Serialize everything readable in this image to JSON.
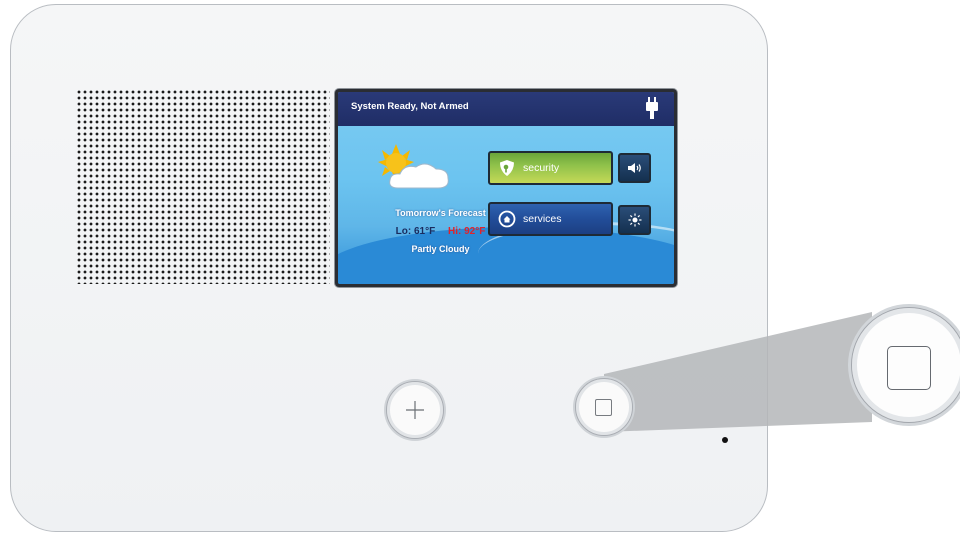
{
  "status": {
    "text": "System Ready, Not Armed",
    "icon": "plug-icon"
  },
  "forecast": {
    "title": "Tomorrow's Forecast",
    "lo": "Lo: 61°F",
    "hi": "Hi: 92°F",
    "condition": "Partly Cloudy",
    "icon": "partly-cloudy-icon"
  },
  "buttons": {
    "security": {
      "label": "security",
      "icon": "shield-icon"
    },
    "services": {
      "label": "services",
      "icon": "home-refresh-icon"
    },
    "volume": {
      "icon": "speaker-volume-icon"
    },
    "brightness": {
      "icon": "brightness-icon"
    }
  },
  "hardware": {
    "plus_button": {
      "icon": "plus-icon"
    },
    "home_button": {
      "icon": "square-icon"
    }
  },
  "colors": {
    "status_bar": "#1f2d66",
    "security_button": "#8fc14a",
    "services_button": "#224d99",
    "hi_temp": "#e0232b",
    "lo_temp": "#1a2b5e"
  }
}
